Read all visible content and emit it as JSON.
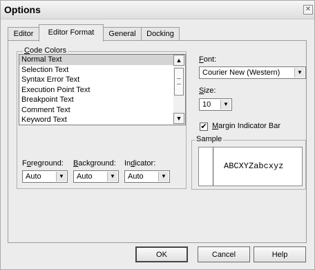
{
  "window": {
    "title": "Options",
    "close_symbol": "✕"
  },
  "tabs": [
    {
      "label": "Editor",
      "active": false
    },
    {
      "label": "Editor Format",
      "active": true
    },
    {
      "label": "General",
      "active": false
    },
    {
      "label": "Docking",
      "active": false
    }
  ],
  "code_colors": {
    "group_label": "Code Colors",
    "items": [
      "Normal Text",
      "Selection Text",
      "Syntax Error Text",
      "Execution Point Text",
      "Breakpoint Text",
      "Comment Text",
      "Keyword Text"
    ],
    "selected": "Normal Text",
    "foreground": {
      "label": "Foreground:",
      "value": "Auto"
    },
    "background": {
      "label": "Background:",
      "value": "Auto"
    },
    "indicator": {
      "label": "Indicator:",
      "value": "Auto"
    }
  },
  "font": {
    "label": "Font:",
    "value": "Courier New (Western)"
  },
  "size": {
    "label": "Size:",
    "value": "10"
  },
  "margin_indicator_bar": {
    "label": "Margin Indicator Bar",
    "checked": true,
    "check_symbol": "✔"
  },
  "sample": {
    "label": "Sample",
    "text": "ABCXYZabcxyz"
  },
  "buttons": {
    "ok": "OK",
    "cancel": "Cancel",
    "help": "Help"
  },
  "icons": {
    "scroll_up": "▲",
    "scroll_down": "▼",
    "dropdown": "▼"
  }
}
